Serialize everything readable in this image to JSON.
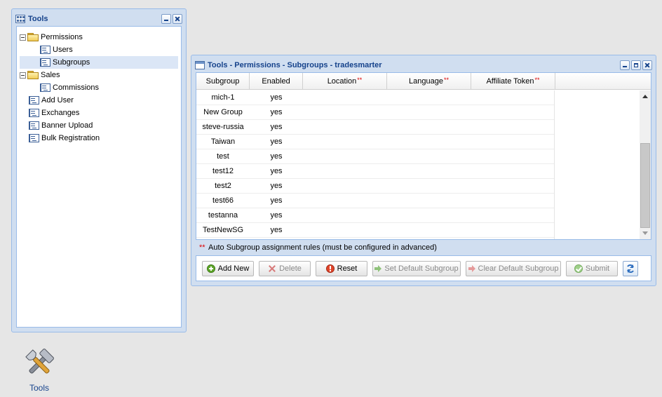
{
  "tools_window": {
    "title": "Tools",
    "tree": [
      {
        "label": "Permissions",
        "type": "folder",
        "level": 0,
        "expanded": true
      },
      {
        "label": "Users",
        "type": "page",
        "level": 1
      },
      {
        "label": "Subgroups",
        "type": "page",
        "level": 1,
        "selected": true
      },
      {
        "label": "Sales",
        "type": "folder",
        "level": 0,
        "expanded": true
      },
      {
        "label": "Commissions",
        "type": "page",
        "level": 1
      },
      {
        "label": "Add User",
        "type": "page",
        "level": 0
      },
      {
        "label": "Exchanges",
        "type": "page",
        "level": 0
      },
      {
        "label": "Banner Upload",
        "type": "page",
        "level": 0
      },
      {
        "label": "Bulk Registration",
        "type": "page",
        "level": 0
      }
    ]
  },
  "desktop_icon": {
    "label": "Tools",
    "icon": "hammer-wrench-icon"
  },
  "subgroups_window": {
    "title": "Tools - Permissions - Subgroups - tradesmarter",
    "columns": [
      {
        "label": "Subgroup",
        "required_mark": ""
      },
      {
        "label": "Enabled",
        "required_mark": ""
      },
      {
        "label": "Location",
        "required_mark": "**"
      },
      {
        "label": "Language",
        "required_mark": "**"
      },
      {
        "label": "Affiliate Token",
        "required_mark": "**"
      }
    ],
    "rows": [
      {
        "subgroup": "mich-1",
        "enabled": "yes"
      },
      {
        "subgroup": "New Group",
        "enabled": "yes"
      },
      {
        "subgroup": "steve-russia",
        "enabled": "yes"
      },
      {
        "subgroup": "Taiwan",
        "enabled": "yes"
      },
      {
        "subgroup": "test",
        "enabled": "yes"
      },
      {
        "subgroup": "test12",
        "enabled": "yes"
      },
      {
        "subgroup": "test2",
        "enabled": "yes"
      },
      {
        "subgroup": "test66",
        "enabled": "yes"
      },
      {
        "subgroup": "testanna",
        "enabled": "yes"
      },
      {
        "subgroup": "TestNewSG",
        "enabled": "yes"
      }
    ],
    "footnote": {
      "mark": "**",
      "text": "Auto Subgroup assignment rules (must be configured in advanced)"
    },
    "buttons": {
      "add_new": "Add New",
      "delete": "Delete",
      "reset": "Reset",
      "set_default": "Set Default Subgroup",
      "clear_default": "Clear Default Subgroup",
      "submit": "Submit"
    }
  },
  "colors": {
    "title_text": "#15428b",
    "window_frame": "#d0def0",
    "required_mark": "#dd0000"
  }
}
